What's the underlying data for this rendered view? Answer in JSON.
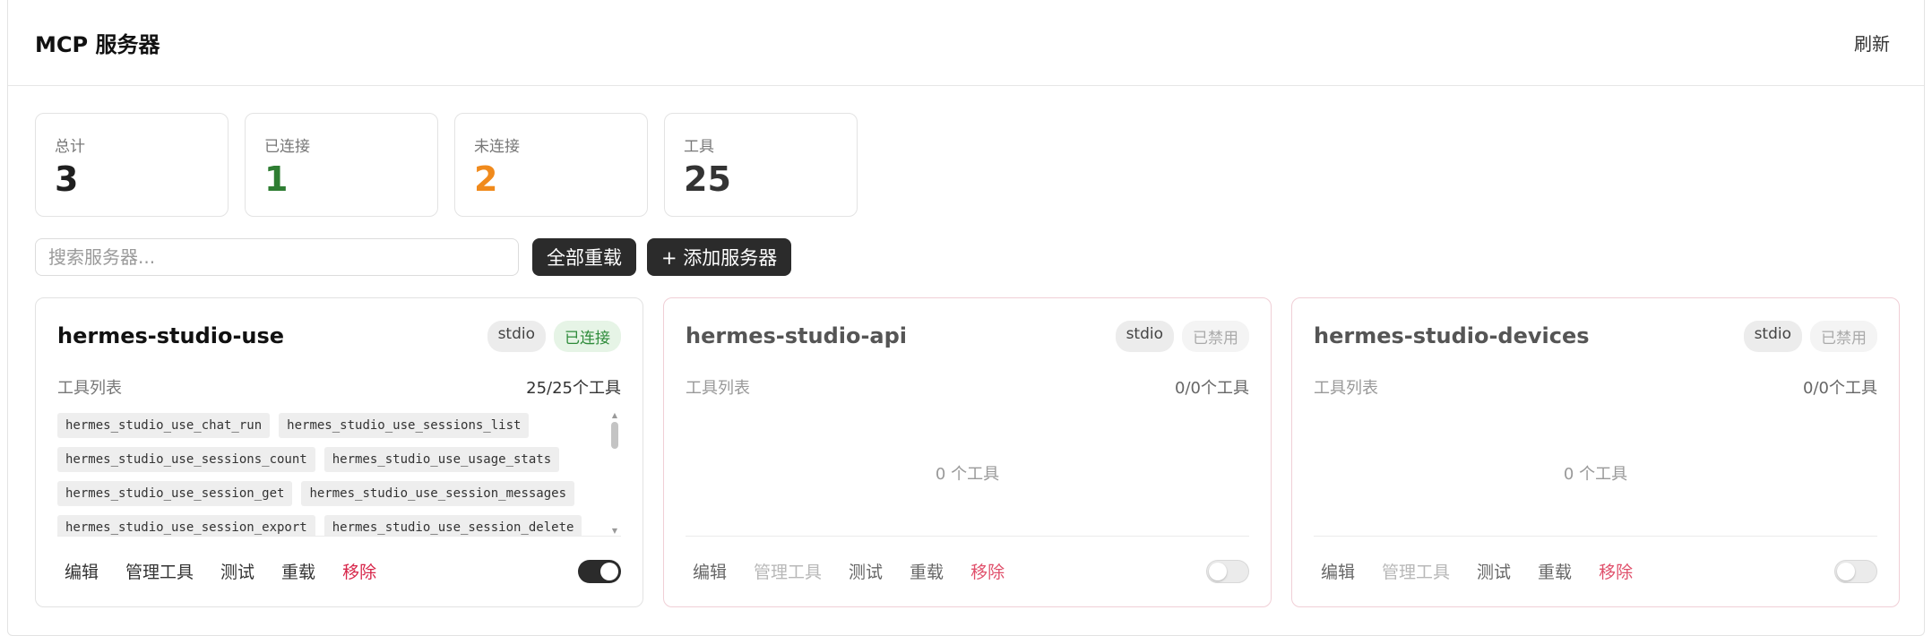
{
  "header": {
    "title": "MCP 服务器",
    "refresh_label": "刷新"
  },
  "stats": [
    {
      "label": "总计",
      "value": "3",
      "color": "#1f1f1f"
    },
    {
      "label": "已连接",
      "value": "1",
      "color": "#2e7d32"
    },
    {
      "label": "未连接",
      "value": "2",
      "color": "#f08a1c"
    },
    {
      "label": "工具",
      "value": "25",
      "color": "#333333"
    }
  ],
  "toolbar": {
    "search_placeholder": "搜索服务器...",
    "reload_all_label": "全部重载",
    "add_label": "+ 添加服务器"
  },
  "servers": [
    {
      "name": "hermes-studio-use",
      "transport": "stdio",
      "status": "已连接",
      "tools_label": "工具列表",
      "tools_count": "25/25个工具",
      "tools": [
        "hermes_studio_use_chat_run",
        "hermes_studio_use_sessions_list",
        "hermes_studio_use_sessions_count",
        "hermes_studio_use_usage_stats",
        "hermes_studio_use_session_get",
        "hermes_studio_use_session_messages",
        "hermes_studio_use_session_export",
        "hermes_studio_use_session_delete"
      ],
      "actions": {
        "edit": "编辑",
        "manage": "管理工具",
        "test": "测试",
        "reload": "重载",
        "remove": "移除"
      },
      "enabled": true
    },
    {
      "name": "hermes-studio-api",
      "transport": "stdio",
      "status": "已禁用",
      "tools_label": "工具列表",
      "tools_count": "0/0个工具",
      "empty_label": "0 个工具",
      "actions": {
        "edit": "编辑",
        "manage": "管理工具",
        "test": "测试",
        "reload": "重载",
        "remove": "移除"
      },
      "enabled": false
    },
    {
      "name": "hermes-studio-devices",
      "transport": "stdio",
      "status": "已禁用",
      "tools_label": "工具列表",
      "tools_count": "0/0个工具",
      "empty_label": "0 个工具",
      "actions": {
        "edit": "编辑",
        "manage": "管理工具",
        "test": "测试",
        "reload": "重载",
        "remove": "移除"
      },
      "enabled": false
    }
  ]
}
